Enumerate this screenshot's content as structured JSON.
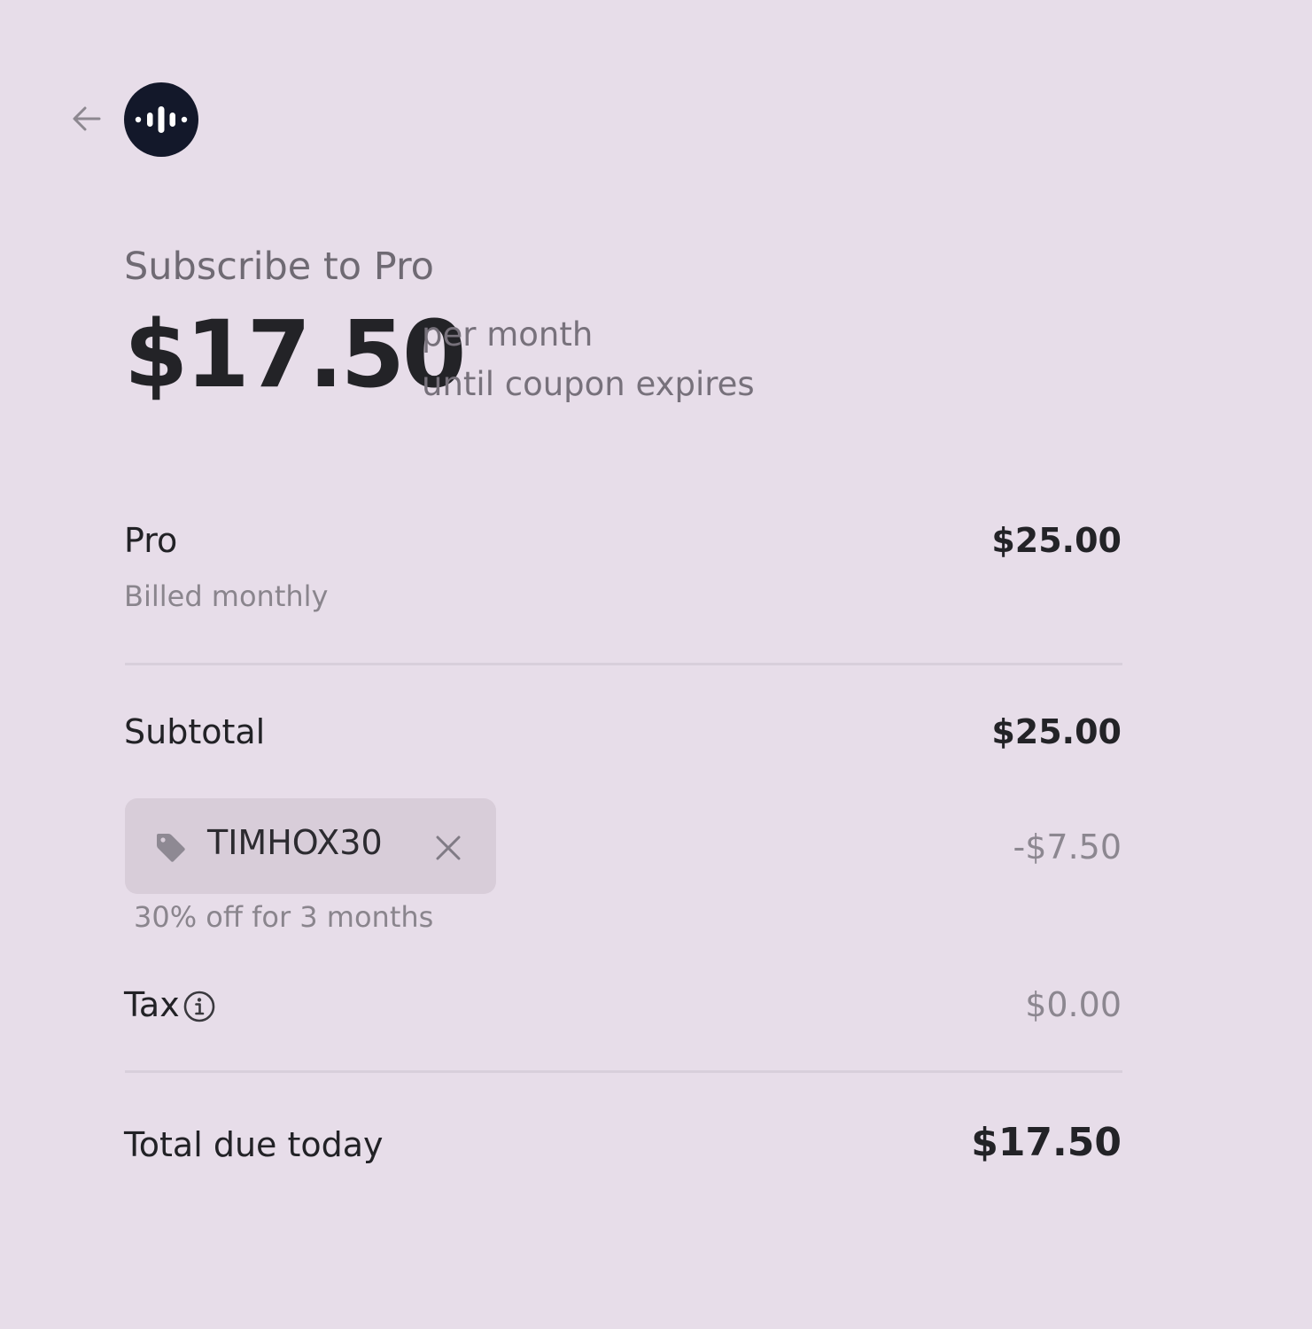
{
  "header": {
    "back_icon": "arrow-left-icon",
    "logo_icon": "audio-waveform-logo"
  },
  "plan": {
    "subscribe_title": "Subscribe to Pro",
    "price": "$17.50",
    "price_period": "per month",
    "price_condition": "until coupon expires"
  },
  "line_items": {
    "pro": {
      "label": "Pro",
      "billing": "Billed monthly",
      "amount": "$25.00"
    },
    "subtotal": {
      "label": "Subtotal",
      "amount": "$25.00"
    },
    "coupon": {
      "code": "TIMHOX30",
      "description": "30% off for 3 months",
      "discount": "-$7.50",
      "tag_icon": "tag-icon",
      "remove_icon": "close-icon"
    },
    "tax": {
      "label": "Tax",
      "amount": "$0.00",
      "info_icon": "info-icon"
    },
    "total": {
      "label": "Total due today",
      "amount": "$17.50"
    }
  },
  "colors": {
    "background": "#e7dde9",
    "logo": "#13182a",
    "coupon_chip": "#d8cdd9",
    "divider": "#d8cfdb"
  }
}
